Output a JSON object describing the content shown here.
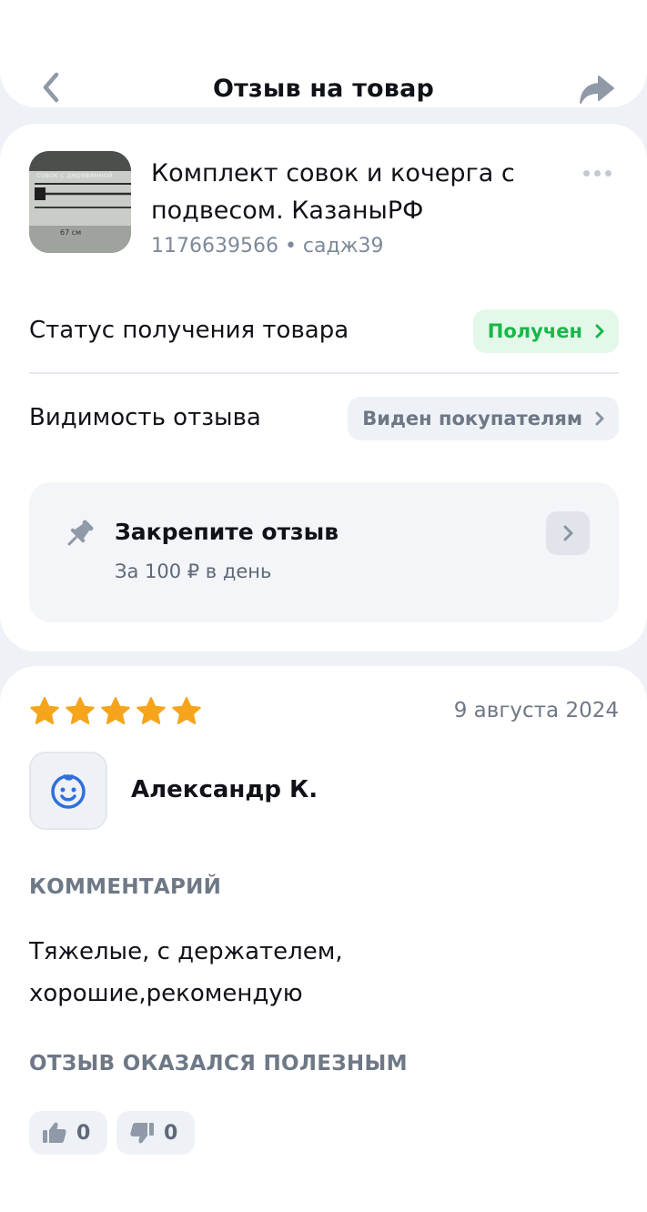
{
  "header": {
    "title": "Отзыв на товар",
    "back_icon": "chevron-left-icon",
    "share_icon": "share-arrow-icon"
  },
  "product": {
    "name": "Комплект совок и кочерга с подвесом. КазаныРФ",
    "meta": "1176639566 • садж39",
    "thumb_caption_top": "совок с деревянной",
    "thumb_caption_size": "67 см",
    "more_icon": "more-dots-icon"
  },
  "status": {
    "label": "Статус получения товара",
    "value": "Получен",
    "color": "#18b74a",
    "background": "#e3f8e9"
  },
  "visibility": {
    "label": "Видимость отзыва",
    "value": "Виден покупателям"
  },
  "pin": {
    "title": "Закрепите отзыв",
    "subtitle": "За 100 ₽ в день",
    "icon": "pin-icon"
  },
  "review": {
    "rating": 5,
    "max_rating": 5,
    "star_color": "#f6a41b",
    "date": "9 августа 2024",
    "author": "Александр К.",
    "avatar_icon": "baby-face-icon",
    "comment_label": "КОММЕНТАРИЙ",
    "comment_line1": "Тяжелые, с держателем,",
    "comment_line2": "хорошие,рекомендую",
    "helpful_label": "ОТЗЫВ ОКАЗАЛСЯ ПОЛЕЗНЫМ",
    "likes": "0",
    "dislikes": "0"
  },
  "colors": {
    "background": "#eef1f5",
    "card": "#ffffff",
    "accent_blue": "#2f6fdd"
  }
}
